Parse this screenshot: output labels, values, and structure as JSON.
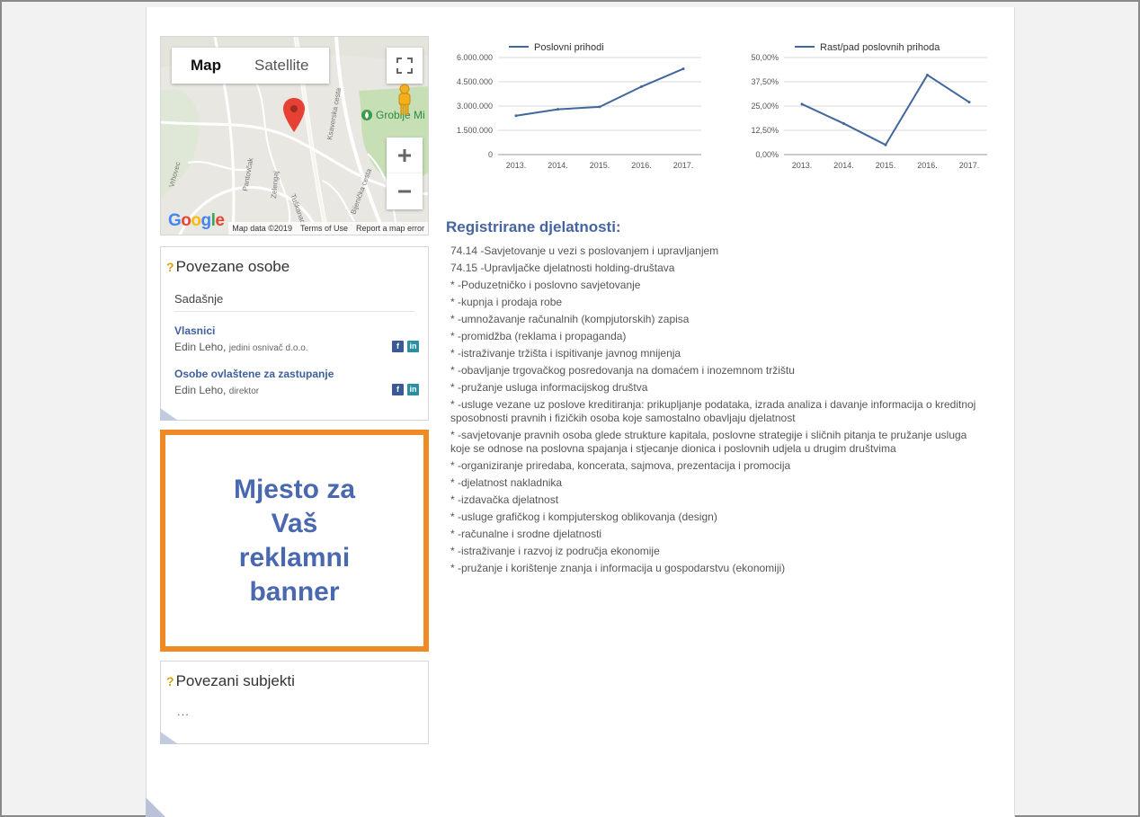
{
  "map": {
    "type_options": [
      "Map",
      "Satellite"
    ],
    "active_type": "Map",
    "place_label": "Groblje Mi",
    "google_logo": "Google",
    "attribution": [
      "Map data ©2019",
      "Terms of Use",
      "Report a map error"
    ],
    "street_labels": [
      "Vrhovec",
      "Pantovčak",
      "Zelengaj",
      "Tuškanac",
      "Bijenička cesta",
      "Ksaverska cesta"
    ],
    "icons": [
      "fullscreen-icon",
      "pegman-icon",
      "zoom-in-icon",
      "zoom-out-icon",
      "location-pin-icon"
    ]
  },
  "people_panel": {
    "title": "Povezane osobe",
    "section": "Sadašnje",
    "groups": [
      {
        "role": "Vlasnici",
        "name": "Edin Leho,",
        "note": "jedini osnivač d.o.o."
      },
      {
        "role": "Osobe ovlaštene za zastupanje",
        "name": "Edin Leho,",
        "note": "direktor"
      }
    ]
  },
  "banner": {
    "text": "Mjesto za\nVaš\nreklamni\nbanner",
    "border_color": "#f08a24",
    "text_color": "#4a68b0"
  },
  "subjects_panel": {
    "title": "Povezani subjekti",
    "content": "..."
  },
  "chart_data": [
    {
      "type": "line",
      "legend": "Poslovni prihodi",
      "categories": [
        "2013.",
        "2014.",
        "2015.",
        "2016.",
        "2017."
      ],
      "ytick_labels": [
        "6.000.000",
        "4.500.000",
        "3.000.000",
        "1.500.000",
        "0"
      ],
      "ylim": [
        0,
        6000000
      ],
      "series": [
        {
          "name": "Poslovni prihodi",
          "values": [
            2400000,
            2800000,
            2950000,
            4200000,
            5300000
          ]
        }
      ],
      "grid": true,
      "legend_position": "top",
      "color": "#41679c"
    },
    {
      "type": "line",
      "legend": "Rast/pad poslovnih prihoda",
      "categories": [
        "2013.",
        "2014.",
        "2015.",
        "2016.",
        "2017."
      ],
      "ytick_labels": [
        "50,00%",
        "37,50%",
        "25,00%",
        "12,50%",
        "0,00%"
      ],
      "ylim": [
        0,
        50
      ],
      "series": [
        {
          "name": "Rast/pad poslovnih prihoda",
          "values": [
            26,
            16,
            5,
            41,
            27
          ]
        }
      ],
      "grid": true,
      "legend_position": "top",
      "color": "#41679c"
    }
  ],
  "activities": {
    "title": "Registrirane djelatnosti:",
    "items": [
      "74.14 -Savjetovanje u vezi s poslovanjem i upravljanjem",
      "74.15 -Upravljačke djelatnosti holding-društava",
      "* -Poduzetničko i poslovno savjetovanje",
      "* -kupnja i prodaja robe",
      "* -umnožavanje računalnih (kompjutorskih) zapisa",
      "* -promidžba (reklama i propaganda)",
      "* -istraživanje tržišta i ispitivanje javnog mnijenja",
      "* -obavljanje trgovačkog posredovanja na domaćem i inozemnom tržištu",
      "* -pružanje usluga informacijskog društva",
      "* -usluge vezane uz poslove kreditiranja: prikupljanje podataka, izrada analiza i davanje informacija o kreditnoj sposobnosti pravnih i fizičkih osoba koje samostalno obavljaju djelatnost",
      "* -savjetovanje pravnih osoba glede strukture kapitala, poslovne strategije i sličnih pitanja te pružanje usluga koje se odnose na poslovna spajanja i stjecanje dionica i poslovnih udjela u drugim društvima",
      "* -organiziranje priredaba, koncerata, sajmova, prezentacija i promocija",
      "* -djelatnost nakladnika",
      "* -izdavačka djelatnost",
      "* -usluge grafičkog i kompjuterskog oblikovanja (design)",
      "* -računalne i srodne djelatnosti",
      "* -istraživanje i razvoj iz područja ekonomije",
      "* -pružanje i korištenje znanja i informacija u gospodarstvu (ekonomiji)"
    ]
  }
}
